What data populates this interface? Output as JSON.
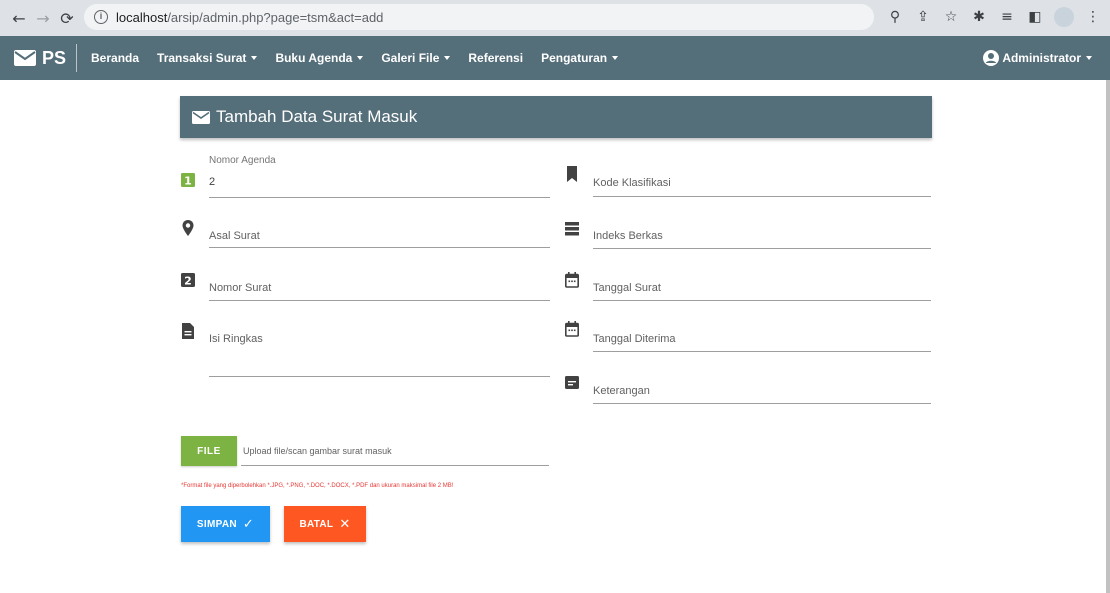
{
  "browser": {
    "url_host": "localhost",
    "url_path": "/arsip/admin.php?page=tsm&act=add"
  },
  "navbar": {
    "brand": "PS",
    "menu": [
      {
        "label": "Beranda",
        "dropdown": false
      },
      {
        "label": "Transaksi Surat",
        "dropdown": true
      },
      {
        "label": "Buku Agenda",
        "dropdown": true
      },
      {
        "label": "Galeri File",
        "dropdown": true
      },
      {
        "label": "Referensi",
        "dropdown": false
      },
      {
        "label": "Pengaturan",
        "dropdown": true
      }
    ],
    "user": "Administrator"
  },
  "form": {
    "title": "Tambah Data Surat Masuk",
    "left": {
      "nomor_agenda": {
        "label": "Nomor Agenda",
        "value": "2"
      },
      "asal_surat": {
        "label": "Asal Surat"
      },
      "nomor_surat": {
        "label": "Nomor Surat"
      },
      "isi_ringkas": {
        "label": "Isi Ringkas"
      }
    },
    "right": {
      "kode_klasifikasi": {
        "label": "Kode Klasifikasi"
      },
      "indeks_berkas": {
        "label": "Indeks Berkas"
      },
      "tanggal_surat": {
        "label": "Tanggal Surat"
      },
      "tanggal_diterima": {
        "label": "Tanggal Diterima"
      },
      "keterangan": {
        "label": "Keterangan"
      }
    },
    "file": {
      "button": "FILE",
      "placeholder": "Upload file/scan gambar surat masuk",
      "note": "*Format file yang diperbolehkan *.JPG, *.PNG, *.DOC, *.DOCX, *.PDF dan ukuran maksimal file 2 MB!"
    },
    "buttons": {
      "save": "SIMPAN",
      "cancel": "BATAL"
    }
  },
  "colors": {
    "primary": "#546e7a",
    "file_button": "#7cb342",
    "save_button": "#2196f3",
    "cancel_button": "#ff5722",
    "note_text": "#e53935"
  }
}
